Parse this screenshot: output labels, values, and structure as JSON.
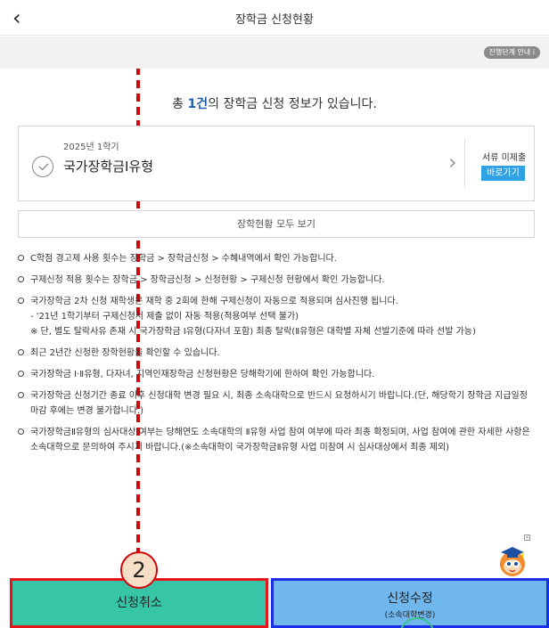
{
  "header": {
    "title": "장학금 신청현황",
    "back_glyph": "‹"
  },
  "guide_button": "진행단계 안내 i",
  "summary": {
    "prefix": "총 ",
    "count": "1건",
    "suffix": "의 장학금 신청 정보가 있습니다."
  },
  "card": {
    "term": "2025년 1학기",
    "scholarship": "국가장학금I유형",
    "status": "서류 미제출",
    "goto_label": "바로가기"
  },
  "view_all": "장학현황 모두 보기",
  "notes": [
    "C학점 경고제 사용 횟수는 장학금 > 장학금신청 > 수혜내역에서 확인 가능합니다.",
    "구제신청 적용 횟수는 장학금 > 장학금신청 > 신청현황 > 구제신청 현황에서 확인 가능합니다.",
    "국가장학금 2차 신청 재학생은 재학 중 2회에 한해 구제신청이 자동으로 적용되며 심사진행 됩니다.",
    "최근 2년간 신청한 장학현황을 확인할 수 있습니다.",
    "국가장학금 Ⅰ·Ⅱ유형, 다자녀, 지역인재장학금 신청현황은 당해학기에 한하여 확인 가능합니다.",
    "국가장학금 신청기간 종료 이후 신청대학 변경 필요 시, 최종 소속대학으로 반드시 요청하시기 바랍니다.(단, 해당학기 장학금 지급일정 마감 후에는 변경 불가합니다.)",
    "국가장학금Ⅱ유형의 심사대상 여부는 당해연도 소속대학의 Ⅱ유형 사업 참여 여부에 따라 최종 확정되며, 사업 참여에 관한 자세한 사항은 소속대학으로 문의하여 주시기 바랍니다.(※소속대학이 국가장학금Ⅱ유형 사업 미참여 시 심사대상에서 최종 제외)"
  ],
  "note_subs": [
    "- '21년 1학기부터 구제신청서 제출 없이 자동 적용(적용여부 선택 불가)",
    "※ 단, 별도 탈락사유 존재 시 국가장학금 Ⅰ유형(다자녀 포함) 최종 탈락(Ⅱ유형은 대학별 자체 선발기준에 따라 선발 가능)"
  ],
  "buttons": {
    "cancel": "신청취소",
    "modify": "신청수정",
    "modify_sub": "(소속대학변경)"
  },
  "step_badge": "2",
  "ad_close": "×",
  "colors": {
    "accent_blue": "#1f5fb0",
    "goto_blue": "#2fa1e5",
    "cancel_bg": "#37c5a8",
    "modify_bg": "#6fb7ed",
    "annotation_red": "#d3070a",
    "annotation_blue": "#1930e8"
  },
  "icons": [
    "back-chevron-icon",
    "check-circle-icon",
    "chevron-right-icon",
    "mascot-icon",
    "ad-close-icon"
  ]
}
